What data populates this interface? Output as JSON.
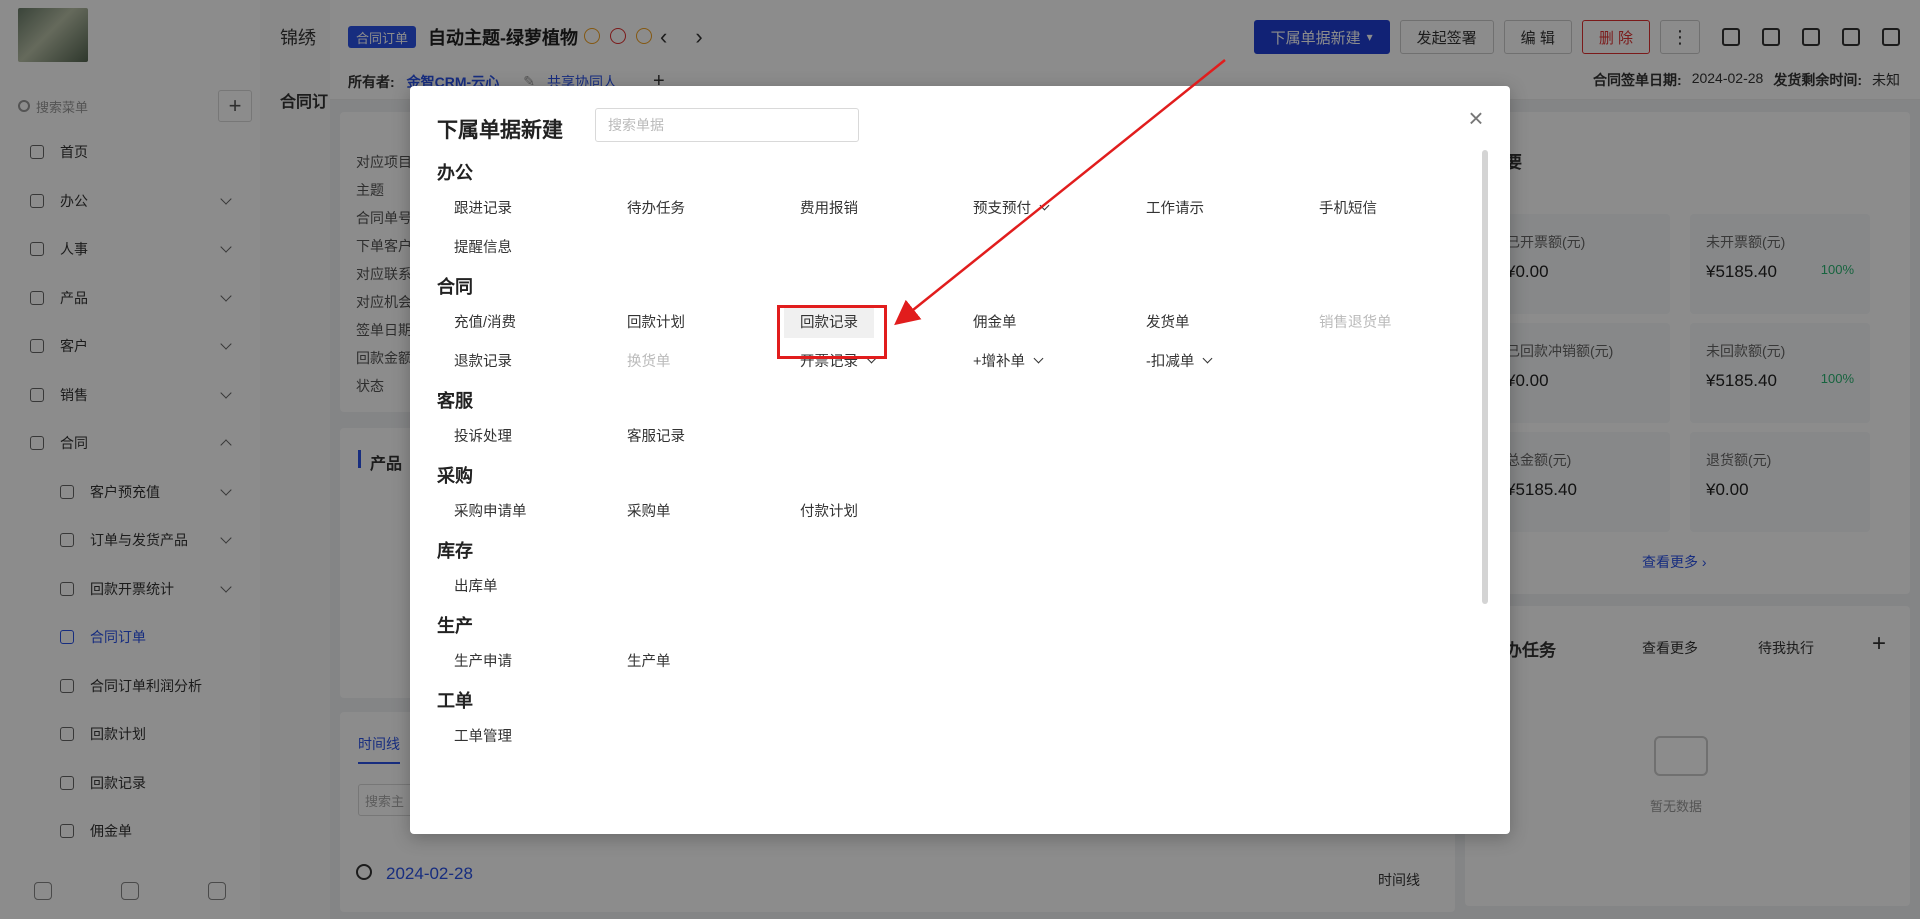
{
  "sidebar": {
    "app_name": "锦绣",
    "search_placeholder": "搜索菜单",
    "add": "+",
    "items": [
      {
        "label": "首页",
        "chev": ""
      },
      {
        "label": "办公",
        "chev": "down"
      },
      {
        "label": "人事",
        "chev": "down"
      },
      {
        "label": "产品",
        "chev": "down"
      },
      {
        "label": "客户",
        "chev": "down"
      },
      {
        "label": "销售",
        "chev": "down"
      },
      {
        "label": "合同",
        "chev": "up"
      }
    ],
    "sub_items": [
      {
        "label": "客户预充值",
        "chev": "down"
      },
      {
        "label": "订单与发货产品",
        "chev": "down"
      },
      {
        "label": "回款开票统计",
        "chev": "down"
      },
      {
        "label": "合同订单",
        "chev": "",
        "active": true
      },
      {
        "label": "合同订单利润分析",
        "chev": ""
      },
      {
        "label": "回款计划",
        "chev": ""
      },
      {
        "label": "回款记录",
        "chev": ""
      },
      {
        "label": "佣金单",
        "chev": ""
      }
    ]
  },
  "list_title": "合同订",
  "header": {
    "badge": "合同订单",
    "title": "自动主题-绿萝植物",
    "buttons": {
      "sub_create": "下属单据新建",
      "sign": "发起签署",
      "edit": "编 辑",
      "delete": "删 除",
      "more": "⋮"
    },
    "owner_label": "所有者:",
    "owner_value": "金智CRM-云心",
    "share_label": "共享协同人",
    "sign_date_label": "合同签单日期:",
    "sign_date_value": "2024-02-28",
    "remain_label": "发货剩余时间:",
    "remain_value": "未知"
  },
  "fields": [
    "对应项目",
    "主题",
    "合同单号",
    "下单客户",
    "对应联系人",
    "对应机会",
    "签单日期",
    "回款金额",
    "状态"
  ],
  "product_label": "产品",
  "summary": {
    "title": "要",
    "cards": [
      {
        "label": "已开票额(元)",
        "value": "¥0.00",
        "pct": ""
      },
      {
        "label": "未开票额(元)",
        "value": "¥5185.40",
        "pct": "100%"
      },
      {
        "label": "已回款冲销额(元)",
        "value": "¥0.00",
        "pct": ""
      },
      {
        "label": "未回款额(元)",
        "value": "¥5185.40",
        "pct": "100%"
      },
      {
        "label": "总金额(元)",
        "value": "¥5185.40",
        "pct": ""
      },
      {
        "label": "退货额(元)",
        "value": "¥0.00",
        "pct": ""
      }
    ],
    "see_more": "查看更多 ›"
  },
  "tasks": {
    "title": "办任务",
    "more": "查看更多",
    "filter": "待我执行",
    "add": "+",
    "empty": "暂无数据"
  },
  "timeline": {
    "tab": "时间线",
    "search_placeholder": "搜索主",
    "date": "2024-02-28",
    "right_label": "时间线"
  },
  "modal": {
    "title": "下属单据新建",
    "search_placeholder": "搜索单据",
    "close": "×",
    "sections": [
      {
        "title": "办公",
        "items": [
          {
            "label": "跟进记录"
          },
          {
            "label": "待办任务"
          },
          {
            "label": "费用报销"
          },
          {
            "label": "预支预付",
            "dropdown": true
          },
          {
            "label": "工作请示"
          },
          {
            "label": "手机短信"
          },
          {
            "label": "提醒信息"
          }
        ]
      },
      {
        "title": "合同",
        "items": [
          {
            "label": "充值/消费"
          },
          {
            "label": "回款计划"
          },
          {
            "label": "回款记录",
            "highlight": true
          },
          {
            "label": "佣金单"
          },
          {
            "label": "发货单"
          },
          {
            "label": "销售退货单",
            "disabled": true
          },
          {
            "label": "退款记录"
          },
          {
            "label": "换货单",
            "disabled": true
          },
          {
            "label": "开票记录",
            "dropdown": true
          },
          {
            "label": "+增补单",
            "dropdown": true
          },
          {
            "label": "-扣减单",
            "dropdown": true
          }
        ]
      },
      {
        "title": "客服",
        "items": [
          {
            "label": "投诉处理"
          },
          {
            "label": "客服记录"
          }
        ]
      },
      {
        "title": "采购",
        "items": [
          {
            "label": "采购申请单"
          },
          {
            "label": "采购单"
          },
          {
            "label": "付款计划"
          }
        ]
      },
      {
        "title": "库存",
        "items": [
          {
            "label": "出库单"
          }
        ]
      },
      {
        "title": "生产",
        "items": [
          {
            "label": "生产申请"
          },
          {
            "label": "生产单"
          }
        ]
      },
      {
        "title": "工单",
        "items": [
          {
            "label": "工单管理"
          }
        ]
      }
    ]
  },
  "colors": {
    "primary": "#1f3fd6",
    "danger": "#e03030",
    "highlight_box": "#e11d1d",
    "success": "#2bb673"
  }
}
